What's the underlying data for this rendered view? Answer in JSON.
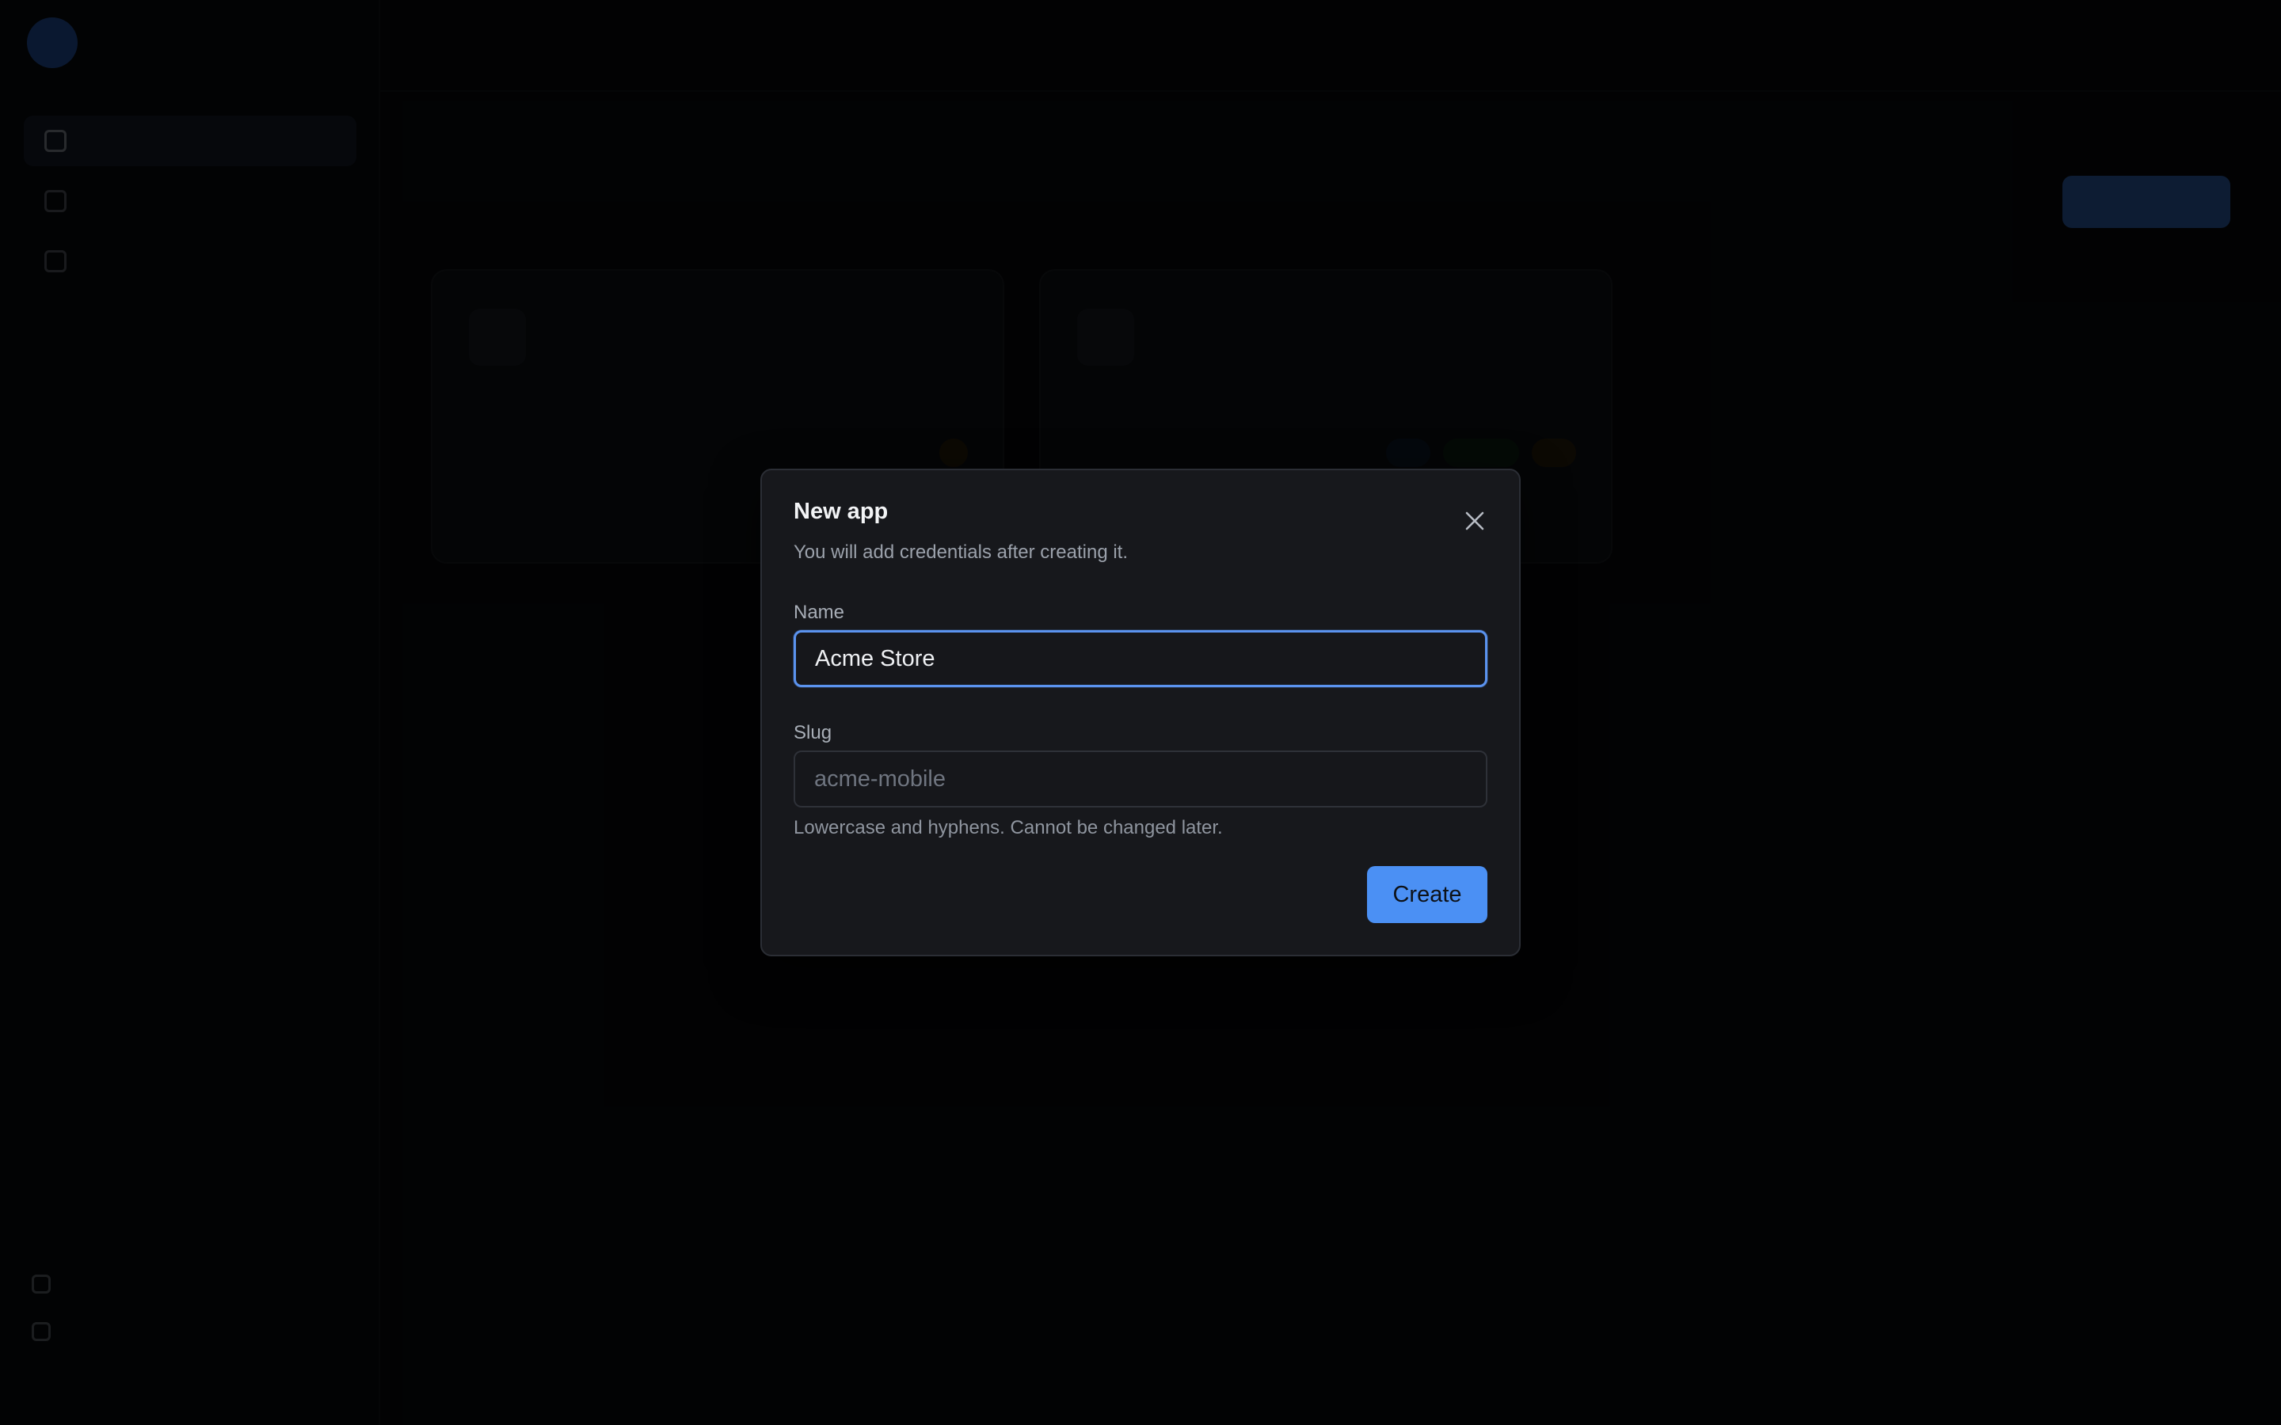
{
  "modal": {
    "title": "New app",
    "subtitle": "You will add credentials after creating it.",
    "name_label": "Name",
    "name_value": "Acme Store",
    "slug_label": "Slug",
    "slug_placeholder": "acme-mobile",
    "slug_helper": "Lowercase and hyphens. Cannot be changed later.",
    "create_label": "Create",
    "close_icon": "close-icon"
  },
  "colors": {
    "accent": "#4b90f4",
    "focus_border": "#5b93ef",
    "modal_bg": "#17181c",
    "backdrop": "#050608"
  }
}
